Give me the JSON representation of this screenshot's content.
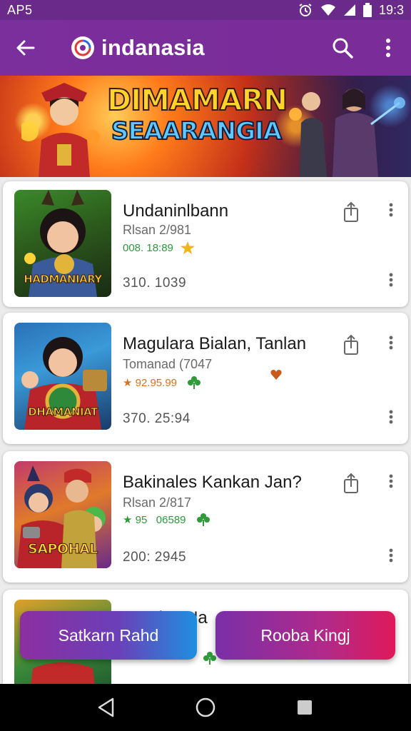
{
  "status_bar": {
    "left_text": "AP5",
    "time": "19:3"
  },
  "app_bar": {
    "title": "indanasia"
  },
  "banner": {
    "line1": "DIMAMARN",
    "line2": "SEAARANGIA"
  },
  "cards": [
    {
      "title": "Undaninlbann",
      "subtitle": "Rlsan 2/981",
      "rating": "008. 18:89",
      "count": "310. 1039",
      "thumb_label": "HADMANIARY",
      "colors": {
        "rating": "#2e9a3a",
        "rating_alt": "#d23a2a"
      }
    },
    {
      "title": "Magulara Bialan, Tanlan",
      "subtitle": "Tomanad (7047",
      "rating": "★ 92.95.99",
      "count": "370. 25:94",
      "thumb_label": "DHAMANIAT"
    },
    {
      "title": "Bakinales Kankan Jan?",
      "subtitle": "Rlsan 2/817",
      "rating": "★ 95   06589",
      "count": "200: 2945",
      "thumb_label": "SAPOHAL"
    },
    {
      "title": "Kandes Na"
    }
  ],
  "actions": {
    "left_label": "Satkarn Rahd",
    "right_label": "Rooba Kingj"
  },
  "nav": {
    "back": "back",
    "home": "home",
    "recents": "recents"
  },
  "colors": {
    "app_bar": "#7b2f9c",
    "status_bar": "#6a2a8a",
    "nav_bar": "#000000"
  },
  "icons": [
    "back-arrow-icon",
    "logo-icon",
    "search-icon",
    "more-vert-icon",
    "share-icon",
    "star-icon",
    "clover-icon",
    "wifi-icon",
    "signal-icon",
    "battery-icon",
    "alarm-icon"
  ]
}
